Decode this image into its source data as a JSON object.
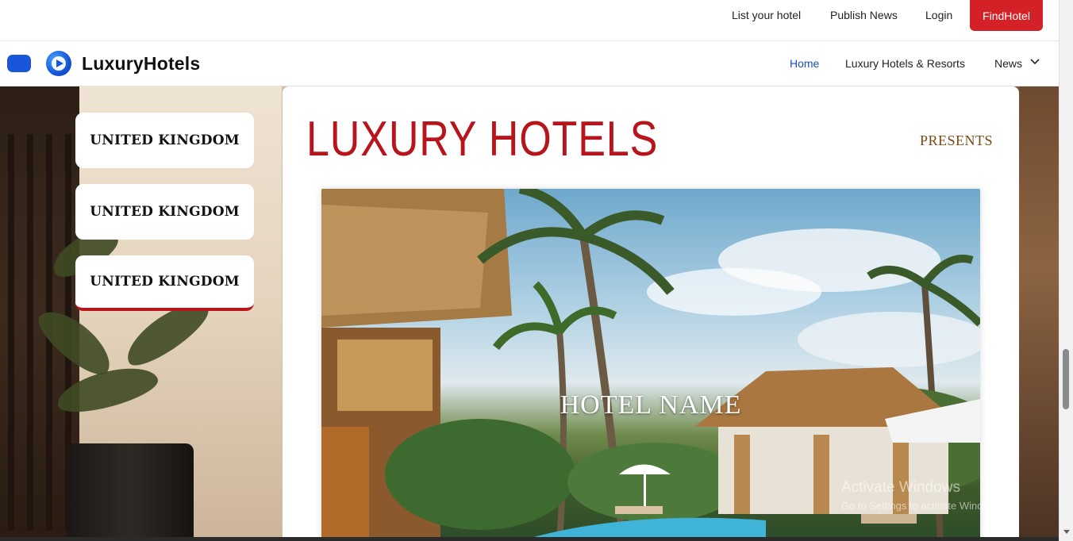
{
  "topbar": {
    "list_hotel": "List your hotel",
    "publish_news": "Publish News",
    "login": "Login",
    "find_hotel": "FindHotel"
  },
  "nav": {
    "brand": "LuxuryHotels",
    "links": {
      "home": "Home",
      "resorts": "Luxury Hotels & Resorts",
      "news": "News"
    }
  },
  "sidebar": {
    "countries": [
      "UNITED KINGDOM",
      "UNITED KINGDOM",
      "UNITED KINGDOM"
    ]
  },
  "feature": {
    "title": "LUXURY HOTELS",
    "presents": "PRESENTS",
    "hotel_name": "HOTEL NAME"
  },
  "watermark": {
    "title": "Activate Windows",
    "subtitle": "Go to Settings to activate Windows."
  },
  "colors": {
    "brand_red": "#d42027",
    "title_red": "#b8141b",
    "link_blue": "#1a4fb8",
    "presents_brown": "#7a4a12"
  },
  "icons": {
    "logo": "play-circle-icon",
    "menu": "menu-pill-icon",
    "news_dropdown": "chevron-down-icon"
  }
}
